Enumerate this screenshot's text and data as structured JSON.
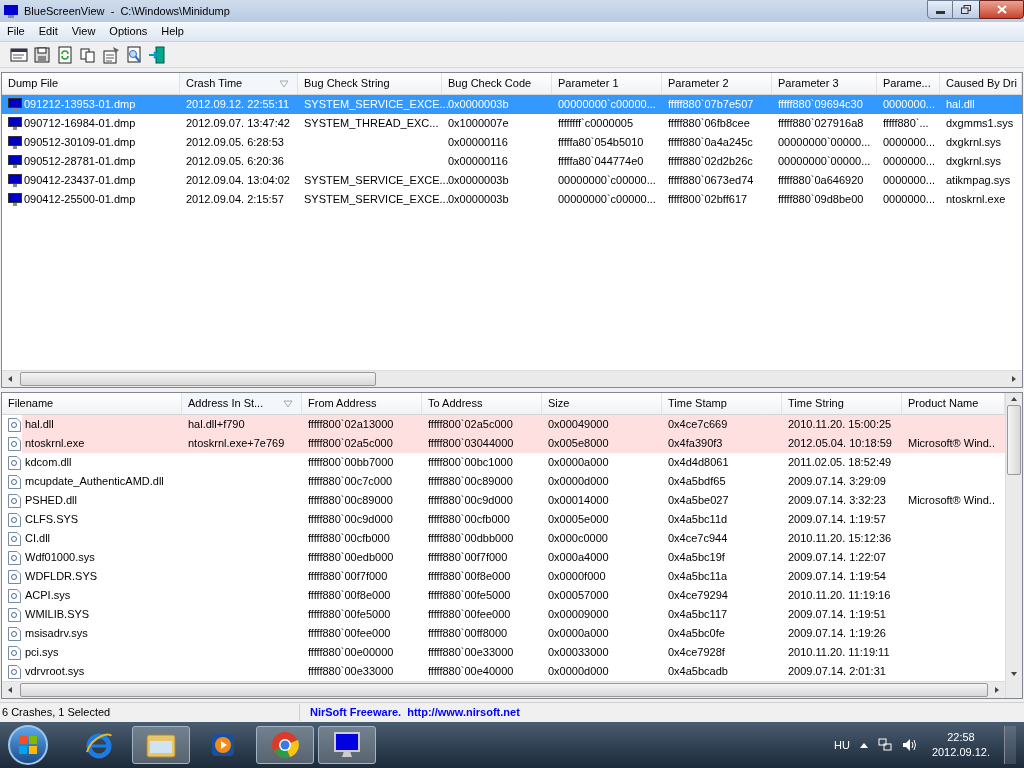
{
  "window": {
    "title": "BlueScreenView  -  C:\\Windows\\Minidump"
  },
  "menu": [
    "File",
    "Edit",
    "View",
    "Options",
    "Help"
  ],
  "toolbar": [
    {
      "kind": "properties"
    },
    {
      "kind": "save"
    },
    {
      "kind": "refresh"
    },
    {
      "kind": "copy"
    },
    {
      "kind": "options"
    },
    {
      "kind": "find"
    },
    {
      "kind": "exit"
    }
  ],
  "crashes": {
    "columns": [
      {
        "label": "Dump File",
        "sorted": false
      },
      {
        "label": "Crash Time",
        "sorted": true
      },
      {
        "label": "Bug Check String",
        "sorted": false
      },
      {
        "label": "Bug Check Code",
        "sorted": false
      },
      {
        "label": "Parameter 1",
        "sorted": false
      },
      {
        "label": "Parameter 2",
        "sorted": false
      },
      {
        "label": "Parameter 3",
        "sorted": false
      },
      {
        "label": "Parame...",
        "sorted": false
      },
      {
        "label": "Caused By Dri",
        "sorted": false
      }
    ],
    "rows": [
      {
        "selected": true,
        "cells": [
          "091212-13953-01.dmp",
          "2012.09.12. 22:55:11",
          "SYSTEM_SERVICE_EXCE...",
          "0x0000003b",
          "00000000`c00000...",
          "fffff880`07b7e507",
          "fffff880`09694c30",
          "0000000...",
          "hal.dll"
        ]
      },
      {
        "selected": false,
        "cells": [
          "090712-16984-01.dmp",
          "2012.09.07. 13:47:42",
          "SYSTEM_THREAD_EXC...",
          "0x1000007e",
          "ffffffff`c0000005",
          "fffff880`06fb8cee",
          "fffff880`027916a8",
          "fffff880`...",
          "dxgmms1.sys"
        ]
      },
      {
        "selected": false,
        "cells": [
          "090512-30109-01.dmp",
          "2012.09.05. 6:28:53",
          "",
          "0x00000116",
          "fffffa80`054b5010",
          "fffff880`0a4a245c",
          "00000000`00000...",
          "0000000...",
          "dxgkrnl.sys"
        ]
      },
      {
        "selected": false,
        "cells": [
          "090512-28781-01.dmp",
          "2012.09.05. 6:20:36",
          "",
          "0x00000116",
          "fffffa80`044774e0",
          "fffff880`02d2b26c",
          "00000000`00000...",
          "0000000...",
          "dxgkrnl.sys"
        ]
      },
      {
        "selected": false,
        "cells": [
          "090412-23437-01.dmp",
          "2012.09.04. 13:04:02",
          "SYSTEM_SERVICE_EXCE...",
          "0x0000003b",
          "00000000`c00000...",
          "fffff880`0673ed74",
          "fffff880`0a646920",
          "0000000...",
          "atikmpag.sys"
        ]
      },
      {
        "selected": false,
        "cells": [
          "090412-25500-01.dmp",
          "2012.09.04. 2:15:57",
          "SYSTEM_SERVICE_EXCE...",
          "0x0000003b",
          "00000000`c00000...",
          "fffff800`02bff617",
          "fffff880`09d8be00",
          "0000000...",
          "ntoskrnl.exe"
        ]
      }
    ]
  },
  "drivers": {
    "columns": [
      {
        "label": "Filename",
        "sorted": false
      },
      {
        "label": "Address In St...",
        "sorted": true
      },
      {
        "label": "From Address",
        "sorted": false
      },
      {
        "label": "To Address",
        "sorted": false
      },
      {
        "label": "Size",
        "sorted": false
      },
      {
        "label": "Time Stamp",
        "sorted": false
      },
      {
        "label": "Time String",
        "sorted": false
      },
      {
        "label": "Product Name",
        "sorted": false
      }
    ],
    "rows": [
      {
        "highlighted": true,
        "cells": [
          "hal.dll",
          "hal.dll+f790",
          "fffff800`02a13000",
          "fffff800`02a5c000",
          "0x00049000",
          "0x4ce7c669",
          "2010.11.20. 15:00:25",
          ""
        ]
      },
      {
        "highlighted": true,
        "cells": [
          "ntoskrnl.exe",
          "ntoskrnl.exe+7e769",
          "fffff800`02a5c000",
          "fffff800`03044000",
          "0x005e8000",
          "0x4fa390f3",
          "2012.05.04. 10:18:59",
          "Microsoft® Wind.."
        ]
      },
      {
        "highlighted": false,
        "cells": [
          "kdcom.dll",
          "",
          "fffff800`00bb7000",
          "fffff800`00bc1000",
          "0x0000a000",
          "0x4d4d8061",
          "2011.02.05. 18:52:49",
          ""
        ]
      },
      {
        "highlighted": false,
        "cells": [
          "mcupdate_AuthenticAMD.dll",
          "",
          "fffff880`00c7c000",
          "fffff880`00c89000",
          "0x0000d000",
          "0x4a5bdf65",
          "2009.07.14. 3:29:09",
          ""
        ]
      },
      {
        "highlighted": false,
        "cells": [
          "PSHED.dll",
          "",
          "fffff880`00c89000",
          "fffff880`00c9d000",
          "0x00014000",
          "0x4a5be027",
          "2009.07.14. 3:32:23",
          "Microsoft® Wind.."
        ]
      },
      {
        "highlighted": false,
        "cells": [
          "CLFS.SYS",
          "",
          "fffff880`00c9d000",
          "fffff880`00cfb000",
          "0x0005e000",
          "0x4a5bc11d",
          "2009.07.14. 1:19:57",
          ""
        ]
      },
      {
        "highlighted": false,
        "cells": [
          "CI.dll",
          "",
          "fffff880`00cfb000",
          "fffff880`00dbb000",
          "0x000c0000",
          "0x4ce7c944",
          "2010.11.20. 15:12:36",
          ""
        ]
      },
      {
        "highlighted": false,
        "cells": [
          "Wdf01000.sys",
          "",
          "fffff880`00edb000",
          "fffff880`00f7f000",
          "0x000a4000",
          "0x4a5bc19f",
          "2009.07.14. 1:22:07",
          ""
        ]
      },
      {
        "highlighted": false,
        "cells": [
          "WDFLDR.SYS",
          "",
          "fffff880`00f7f000",
          "fffff880`00f8e000",
          "0x0000f000",
          "0x4a5bc11a",
          "2009.07.14. 1:19:54",
          ""
        ]
      },
      {
        "highlighted": false,
        "cells": [
          "ACPI.sys",
          "",
          "fffff880`00f8e000",
          "fffff880`00fe5000",
          "0x00057000",
          "0x4ce79294",
          "2010.11.20. 11:19:16",
          ""
        ]
      },
      {
        "highlighted": false,
        "cells": [
          "WMILIB.SYS",
          "",
          "fffff880`00fe5000",
          "fffff880`00fee000",
          "0x00009000",
          "0x4a5bc117",
          "2009.07.14. 1:19:51",
          ""
        ]
      },
      {
        "highlighted": false,
        "cells": [
          "msisadrv.sys",
          "",
          "fffff880`00fee000",
          "fffff880`00ff8000",
          "0x0000a000",
          "0x4a5bc0fe",
          "2009.07.14. 1:19:26",
          ""
        ]
      },
      {
        "highlighted": false,
        "cells": [
          "pci.sys",
          "",
          "fffff880`00e00000",
          "fffff880`00e33000",
          "0x00033000",
          "0x4ce7928f",
          "2010.11.20. 11:19:11",
          ""
        ]
      },
      {
        "highlighted": false,
        "cells": [
          "vdrvroot.sys",
          "",
          "fffff880`00e33000",
          "fffff880`00e40000",
          "0x0000d000",
          "0x4a5bcadb",
          "2009.07.14. 2:01:31",
          ""
        ]
      }
    ]
  },
  "status_bar": {
    "summary": "6 Crashes, 1 Selected",
    "credit": "NirSoft Freeware.  http://www.nirsoft.net"
  },
  "taskbar": {
    "apps": [
      {
        "kind": "ie",
        "active": false
      },
      {
        "kind": "explorer",
        "active": true
      },
      {
        "kind": "media",
        "active": false
      },
      {
        "kind": "chrome",
        "active": true
      },
      {
        "kind": "bluescreen",
        "active": true
      }
    ],
    "language": "HU",
    "time": "22:58",
    "date": "2012.09.12."
  }
}
